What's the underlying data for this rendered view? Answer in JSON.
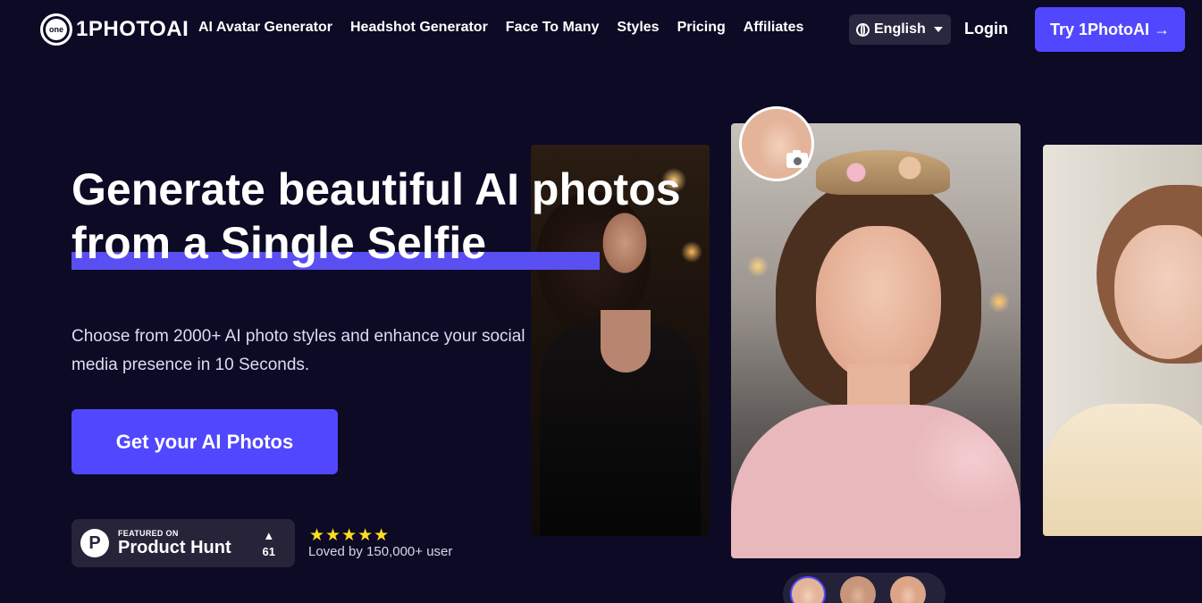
{
  "nav": {
    "logo_text": "1PHOTOAI",
    "logo_badge": "one",
    "links": [
      "AI Avatar Generator",
      "Headshot Generator",
      "Face To Many",
      "Styles",
      "Pricing",
      "Affiliates"
    ],
    "language": "English",
    "login": "Login",
    "try_button": "Try 1PhotoAI →"
  },
  "hero": {
    "headline_line1": "Generate beautiful AI photos",
    "headline_line2": "from a Single Selfie",
    "subtext": "Choose from 2000+ AI photo styles and enhance your social media presence in 10 Seconds.",
    "cta": "Get your AI Photos",
    "product_hunt": {
      "featured": "FEATURED ON",
      "name": "Product Hunt",
      "arrow": "▲",
      "votes": "61"
    },
    "stars": "★★★★★",
    "loved": "Loved by 150,000+ user"
  },
  "colors": {
    "background": "#0c0a24",
    "accent": "#5147ff",
    "star": "#ffde21"
  }
}
